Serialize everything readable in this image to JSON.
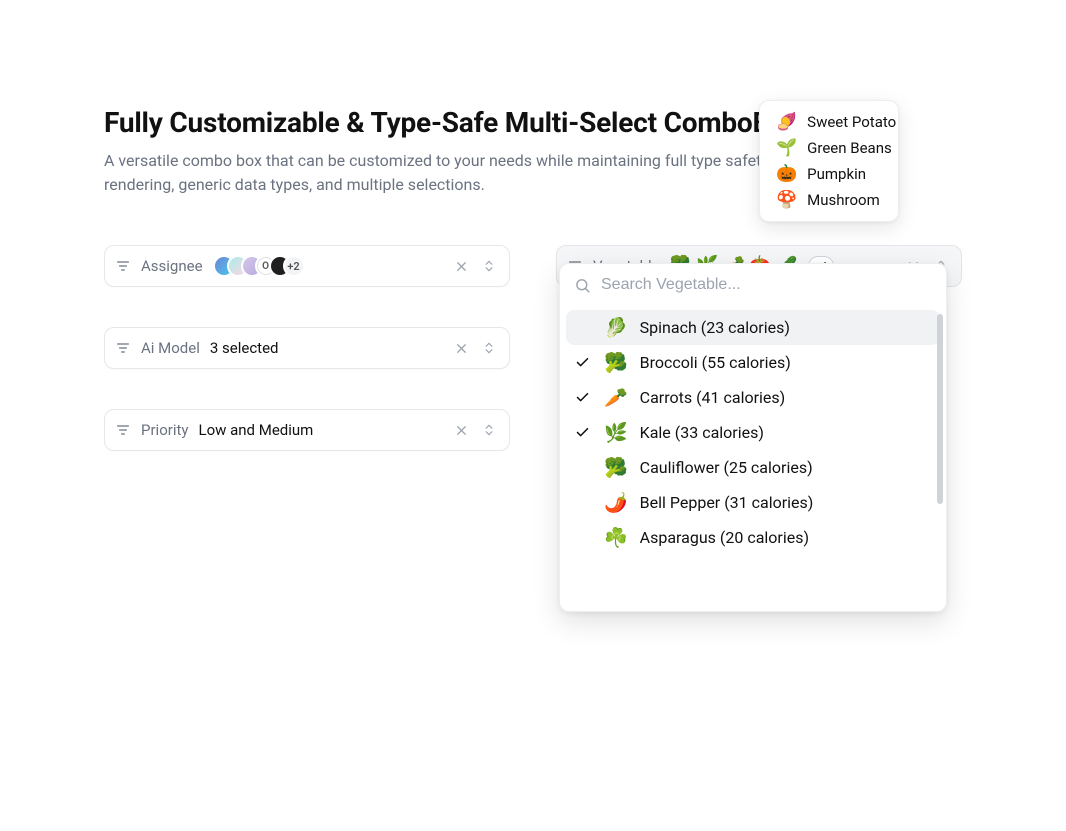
{
  "header": {
    "title": "Fully Customizable & Type-Safe Multi-Select ComboBox",
    "subtitle": "A versatile combo box that can be customized to your needs while maintaining full type safety. Supports custom rendering, generic data types, and multiple selections."
  },
  "combos": {
    "assignee": {
      "label": "Assignee",
      "avatars": [
        {
          "text": "",
          "bg1": "#6f86d6",
          "bg2": "#48c6ef"
        },
        {
          "text": "",
          "bg1": "#a8edea",
          "bg2": "#fed6e3"
        },
        {
          "text": "",
          "bg1": "#d4c8eb",
          "bg2": "#b9a8e0"
        },
        {
          "text": "O",
          "bg1": "#ffffff",
          "bg2": "#ffffff"
        },
        {
          "text": "",
          "bg1": "#1f1f1f",
          "bg2": "#1f1f1f"
        }
      ],
      "more": "+2"
    },
    "aimodel": {
      "label": "Ai Model",
      "value": "3 selected"
    },
    "priority": {
      "label": "Priority",
      "value": "Low and Medium"
    },
    "vegetable": {
      "label": "Vegetable",
      "selected_emojis": [
        "🥦",
        "🌿",
        "🥕",
        "🍅",
        "🥒"
      ],
      "more": "+4",
      "search_placeholder": "Search Vegetable...",
      "options": [
        {
          "checked": false,
          "emoji": "🥬",
          "label": "Spinach (23 calories)",
          "highlight": true
        },
        {
          "checked": true,
          "emoji": "🥦",
          "label": "Broccoli (55 calories)",
          "highlight": false
        },
        {
          "checked": true,
          "emoji": "🥕",
          "label": "Carrots (41 calories)",
          "highlight": false
        },
        {
          "checked": true,
          "emoji": "🌿",
          "label": "Kale (33 calories)",
          "highlight": false
        },
        {
          "checked": false,
          "emoji": "🥦",
          "label": "Cauliflower (25 calories)",
          "highlight": false
        },
        {
          "checked": false,
          "emoji": "🌶️",
          "label": "Bell Pepper (31 calories)",
          "highlight": false
        },
        {
          "checked": false,
          "emoji": "☘️",
          "label": "Asparagus (20 calories)",
          "highlight": false
        }
      ]
    }
  },
  "overflow": [
    {
      "emoji": "🍠",
      "label": "Sweet Potato"
    },
    {
      "emoji": "🌱",
      "label": "Green Beans"
    },
    {
      "emoji": "🎃",
      "label": "Pumpkin"
    },
    {
      "emoji": "🍄",
      "label": "Mushroom"
    }
  ]
}
